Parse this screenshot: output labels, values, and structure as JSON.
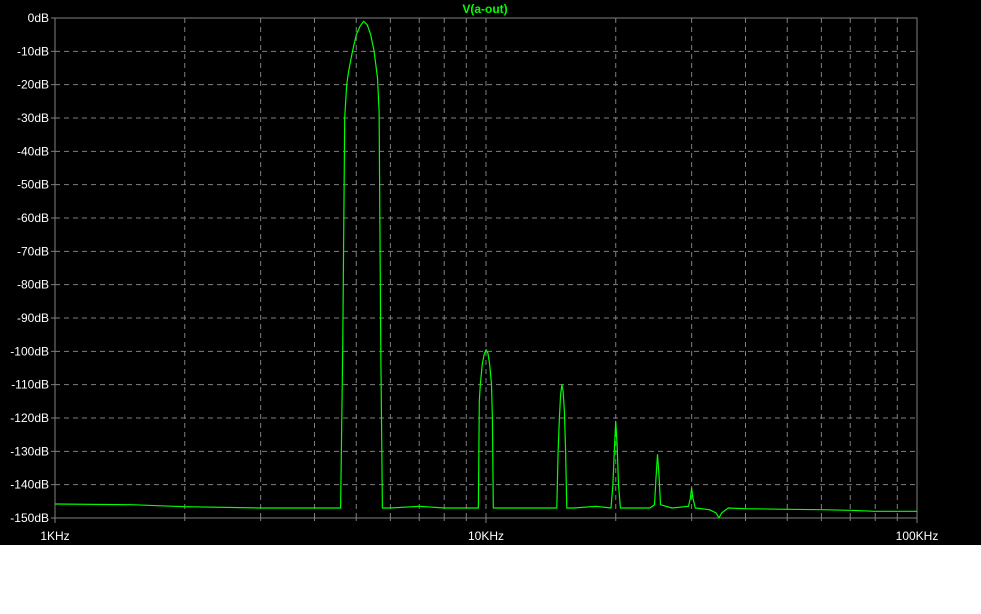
{
  "chart_data": {
    "type": "line",
    "title": "V(a-out)",
    "xlabel": "",
    "ylabel": "",
    "x_scale": "log",
    "xlim": [
      1000,
      100000
    ],
    "ylim": [
      -150,
      0
    ],
    "grid": true,
    "x_ticks": [
      {
        "value": 1000,
        "label": "1KHz"
      },
      {
        "value": 10000,
        "label": "10KHz"
      },
      {
        "value": 100000,
        "label": "100KHz"
      }
    ],
    "y_ticks": [
      {
        "value": 0,
        "label": "0dB"
      },
      {
        "value": -10,
        "label": "-10dB"
      },
      {
        "value": -20,
        "label": "-20dB"
      },
      {
        "value": -30,
        "label": "-30dB"
      },
      {
        "value": -40,
        "label": "-40dB"
      },
      {
        "value": -50,
        "label": "-50dB"
      },
      {
        "value": -60,
        "label": "-60dB"
      },
      {
        "value": -70,
        "label": "-70dB"
      },
      {
        "value": -80,
        "label": "-80dB"
      },
      {
        "value": -90,
        "label": "-90dB"
      },
      {
        "value": -100,
        "label": "-100dB"
      },
      {
        "value": -110,
        "label": "-110dB"
      },
      {
        "value": -120,
        "label": "-120dB"
      },
      {
        "value": -130,
        "label": "-130dB"
      },
      {
        "value": -140,
        "label": "-140dB"
      },
      {
        "value": -150,
        "label": "-150dB"
      }
    ],
    "series": [
      {
        "name": "V(a-out)",
        "color": "#00ff00",
        "points": [
          [
            1000,
            -145.8
          ],
          [
            1500,
            -146.0
          ],
          [
            2000,
            -146.6
          ],
          [
            3000,
            -147.0
          ],
          [
            4000,
            -147.0
          ],
          [
            4600,
            -147.0
          ],
          [
            4650,
            -100.0
          ],
          [
            4700,
            -30.0
          ],
          [
            4750,
            -20.0
          ],
          [
            4800,
            -16.0
          ],
          [
            4900,
            -10.0
          ],
          [
            5000,
            -5.0
          ],
          [
            5100,
            -2.5
          ],
          [
            5200,
            -1.0
          ],
          [
            5300,
            -2.0
          ],
          [
            5400,
            -5.0
          ],
          [
            5500,
            -10.0
          ],
          [
            5600,
            -18.0
          ],
          [
            5650,
            -28.0
          ],
          [
            5700,
            -100.0
          ],
          [
            5750,
            -147.0
          ],
          [
            6000,
            -147.0
          ],
          [
            7000,
            -146.5
          ],
          [
            8000,
            -147.0
          ],
          [
            9000,
            -147.0
          ],
          [
            9600,
            -147.0
          ],
          [
            9650,
            -115.0
          ],
          [
            9700,
            -110.0
          ],
          [
            9800,
            -104.0
          ],
          [
            9900,
            -101.0
          ],
          [
            10000,
            -99.5
          ],
          [
            10100,
            -100.5
          ],
          [
            10200,
            -104.0
          ],
          [
            10300,
            -110.0
          ],
          [
            10350,
            -120.0
          ],
          [
            10400,
            -147.0
          ],
          [
            11000,
            -147.0
          ],
          [
            12000,
            -147.0
          ],
          [
            13000,
            -147.0
          ],
          [
            14000,
            -147.0
          ],
          [
            14600,
            -147.0
          ],
          [
            14700,
            -130.0
          ],
          [
            14800,
            -120.0
          ],
          [
            14900,
            -113.0
          ],
          [
            15000,
            -110.0
          ],
          [
            15100,
            -112.0
          ],
          [
            15200,
            -118.0
          ],
          [
            15300,
            -130.0
          ],
          [
            15400,
            -147.0
          ],
          [
            16000,
            -147.0
          ],
          [
            18000,
            -146.5
          ],
          [
            19500,
            -147.0
          ],
          [
            19700,
            -140.0
          ],
          [
            19850,
            -130.0
          ],
          [
            20000,
            -121.0
          ],
          [
            20150,
            -128.0
          ],
          [
            20300,
            -140.0
          ],
          [
            20500,
            -147.0
          ],
          [
            22000,
            -147.0
          ],
          [
            24000,
            -147.0
          ],
          [
            24600,
            -146.0
          ],
          [
            24800,
            -138.0
          ],
          [
            25000,
            -131.0
          ],
          [
            25200,
            -137.0
          ],
          [
            25400,
            -146.0
          ],
          [
            27000,
            -147.0
          ],
          [
            29500,
            -146.5
          ],
          [
            29800,
            -144.0
          ],
          [
            30000,
            -141.0
          ],
          [
            30200,
            -144.0
          ],
          [
            30600,
            -147.0
          ],
          [
            33000,
            -147.5
          ],
          [
            34200,
            -148.5
          ],
          [
            34700,
            -150.0
          ],
          [
            35200,
            -148.5
          ],
          [
            36500,
            -147.0
          ],
          [
            40000,
            -147.2
          ],
          [
            50000,
            -147.4
          ],
          [
            60000,
            -147.5
          ],
          [
            70000,
            -147.7
          ],
          [
            80000,
            -148.0
          ],
          [
            90000,
            -148.0
          ],
          [
            100000,
            -148.0
          ]
        ]
      }
    ],
    "colors": {
      "background": "#000000",
      "grid": "#808080",
      "axis_frame": "#808080",
      "tick_text": "#ffffff",
      "title_text": "#00ff00"
    }
  }
}
